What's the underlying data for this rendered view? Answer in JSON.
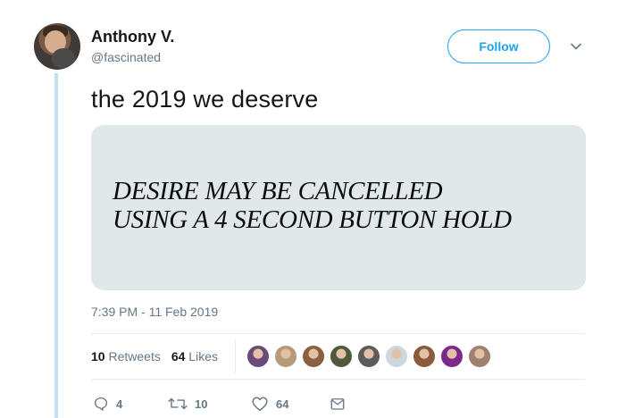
{
  "author": {
    "display_name": "Anthony V.",
    "handle": "@fascinated",
    "avatar_icon": "profile-photo-man-with-cat"
  },
  "follow_button": {
    "label": "Follow"
  },
  "menu_icon": "chevron-down-icon",
  "tweet": {
    "text": "the 2019 we deserve",
    "media": {
      "line1": "DESIRE MAY BE CANCELLED",
      "line2": "USING A 4 SECOND BUTTON HOLD",
      "background": "#e1e8ea"
    },
    "timestamp": "7:39 PM - 11 Feb 2019"
  },
  "stats": {
    "retweets_count": "10",
    "retweets_label": "Retweets",
    "likes_count": "64",
    "likes_label": "Likes"
  },
  "likers": [
    {
      "icon": "avatar-1",
      "color": "#6a4a7a"
    },
    {
      "icon": "avatar-2",
      "color": "#b89a7a"
    },
    {
      "icon": "avatar-3",
      "color": "#8a6040"
    },
    {
      "icon": "avatar-4",
      "color": "#4e5a3a"
    },
    {
      "icon": "avatar-5",
      "color": "#5c5c5c"
    },
    {
      "icon": "avatar-6-default",
      "color": "#ccd6dd"
    },
    {
      "icon": "avatar-7",
      "color": "#8a5a3a"
    },
    {
      "icon": "avatar-8",
      "color": "#7a2a8a"
    },
    {
      "icon": "avatar-9",
      "color": "#a08070"
    }
  ],
  "actions": {
    "reply_count": "4",
    "retweet_count": "10",
    "like_count": "64"
  },
  "colors": {
    "accent": "#1da1f2",
    "muted": "#657786",
    "thread_line": "#c4dff3"
  }
}
